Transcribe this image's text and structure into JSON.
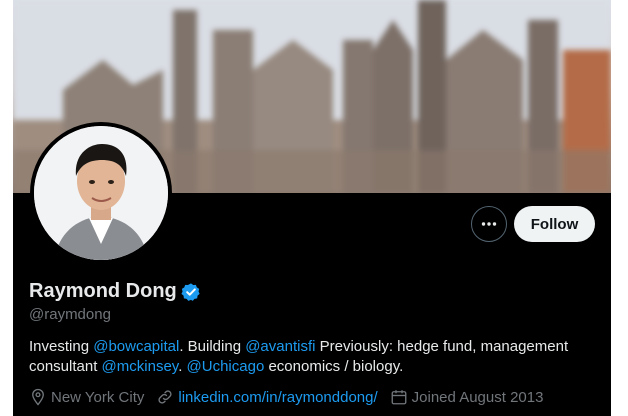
{
  "colors": {
    "background": "#000000",
    "text_primary": "#e7e9ea",
    "text_secondary": "#71767b",
    "accent": "#1d9bf0",
    "follow_bg": "#eff3f4"
  },
  "profile": {
    "display_name": "Raymond Dong",
    "handle": "@raymdong",
    "verified": true,
    "follow_label": "Follow",
    "more_icon": "ellipsis-icon",
    "bio": {
      "part1": "Investing ",
      "mention1": "@bowcapital",
      "part2": ". Building ",
      "mention2": "@avantisfi",
      "part3": " Previously: hedge fund, management consultant ",
      "mention3": "@mckinsey",
      "part4": ". ",
      "mention4": "@Uchicago",
      "part5": " economics / biology."
    },
    "location": "New York City",
    "website": "linkedin.com/in/raymonddong/",
    "joined": "Joined August 2013"
  }
}
